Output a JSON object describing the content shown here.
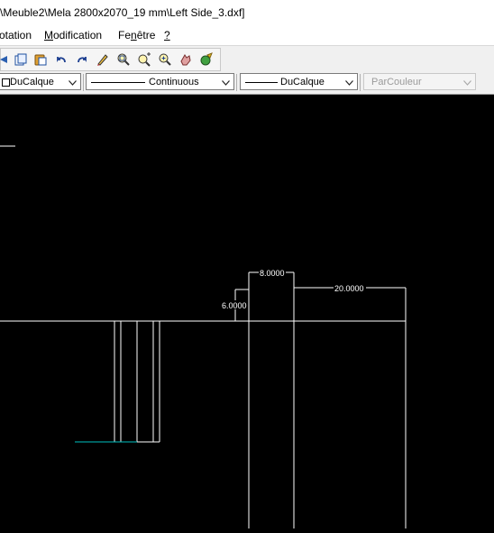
{
  "window": {
    "title": "\\Meuble2\\Mela 2800x2070_19 mm\\Left Side_3.dxf]"
  },
  "menu": {
    "items": [
      {
        "label_pre": "",
        "label_ul": "",
        "label_post": "otation"
      },
      {
        "label_pre": "",
        "label_ul": "M",
        "label_post": "odification"
      },
      {
        "label_pre": "Fe",
        "label_ul": "n",
        "label_post": "être"
      },
      {
        "label_pre": "",
        "label_ul": "?",
        "label_post": ""
      }
    ]
  },
  "toolbar": {
    "icons": [
      "pan-icon",
      "copy-icon",
      "paste-icon",
      "undo-icon",
      "redo-icon",
      "match-properties-icon",
      "zoom-window-icon",
      "zoom-realtime-icon",
      "zoom-extents-icon",
      "pan-realtime-icon",
      "render-icon"
    ]
  },
  "properties": {
    "layer": "DuCalque",
    "linetype": "Continuous",
    "lineweight": "DuCalque",
    "color": "ParCouleur"
  },
  "colors": {
    "canvas_bg": "#000000",
    "geometry": "#ffffff",
    "cyan_line": "#00c0c0"
  },
  "drawing": {
    "dimensions": {
      "top_width": "8.0000",
      "right_width": "20.0000",
      "height": "6.0000"
    }
  }
}
